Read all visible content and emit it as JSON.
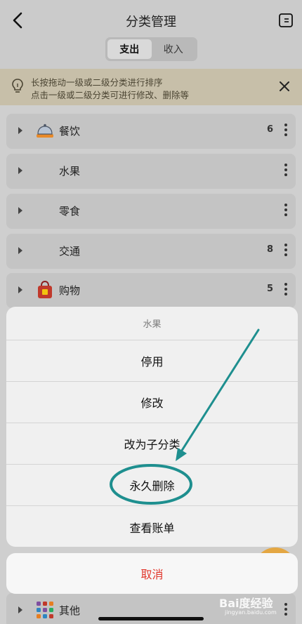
{
  "header": {
    "title": "分类管理",
    "tabs": [
      {
        "label": "支出",
        "active": true
      },
      {
        "label": "收入",
        "active": false
      }
    ]
  },
  "tip": {
    "line1": "长按拖动一级或二级分类进行排序",
    "line2": "点击一级或二级分类可进行修改、删除等"
  },
  "categories": [
    {
      "label": "餐饮",
      "count": "6",
      "icon": "dining-cloche-icon"
    },
    {
      "label": "水果",
      "count": "",
      "icon": ""
    },
    {
      "label": "零食",
      "count": "",
      "icon": ""
    },
    {
      "label": "交通",
      "count": "8",
      "icon": ""
    },
    {
      "label": "购物",
      "count": "5",
      "icon": "shopping-bag-icon"
    },
    {
      "label": "其他",
      "count": "",
      "icon": "grid-apps-icon"
    }
  ],
  "action_sheet": {
    "title": "水果",
    "items": [
      "停用",
      "修改",
      "改为子分类",
      "永久删除",
      "查看账单"
    ],
    "cancel": "取消",
    "highlighted_item": "永久删除"
  },
  "watermark": {
    "text": "Bai度经验",
    "sub": "jingyan.baidu.com"
  },
  "colors": {
    "cancel_red": "#e1352b",
    "annotation_teal": "#1e8f8f",
    "tip_bg": "#c7bfa9"
  }
}
